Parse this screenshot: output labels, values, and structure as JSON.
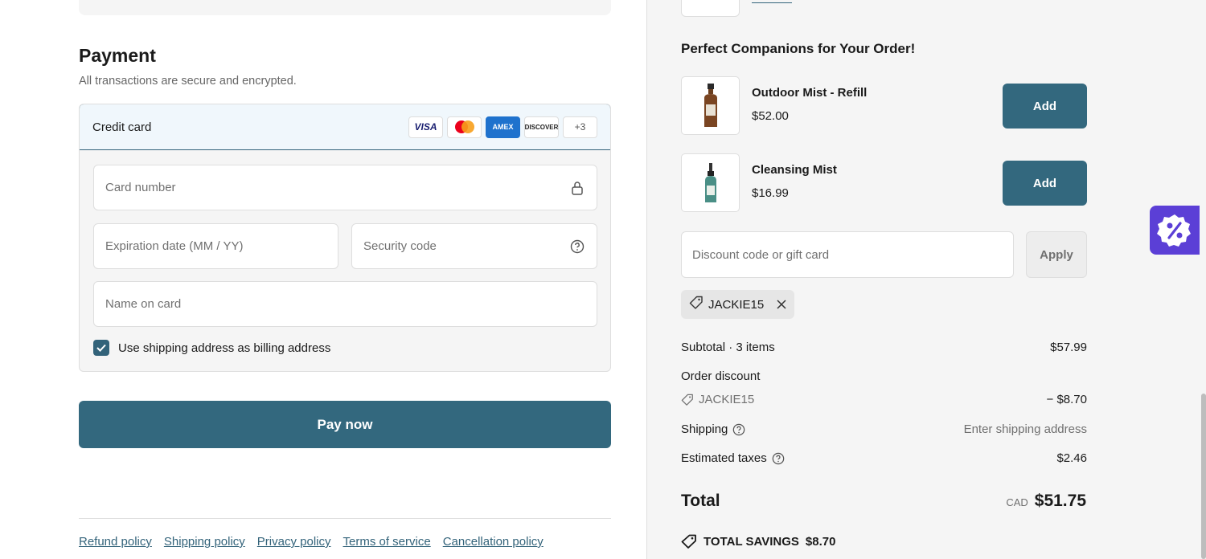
{
  "payment": {
    "title": "Payment",
    "subtitle": "All transactions are secure and encrypted.",
    "method_label": "Credit card",
    "card_logos": [
      "VISA",
      "mastercard",
      "AMEX",
      "DISCOVER"
    ],
    "more_cards": "+3",
    "fields": {
      "card_number": "Card number",
      "expiration": "Expiration date (MM / YY)",
      "security_code": "Security code",
      "name_on_card": "Name on card"
    },
    "billing_checkbox_label": "Use shipping address as billing address",
    "billing_checked": true,
    "pay_button": "Pay now"
  },
  "footer": {
    "links": [
      "Refund policy",
      "Shipping policy",
      "Privacy policy",
      "Terms of service",
      "Cancellation policy"
    ]
  },
  "sidebar": {
    "companions_title": "Perfect Companions for Your Order!",
    "products": [
      {
        "name": "Outdoor Mist - Refill",
        "price": "$52.00",
        "button": "Add"
      },
      {
        "name": "Cleansing Mist",
        "price": "$16.99",
        "button": "Add"
      }
    ],
    "discount_placeholder": "Discount code or gift card",
    "apply_button": "Apply",
    "applied_code": "JACKIE15",
    "summary": {
      "subtotal_label": "Subtotal · 3 items",
      "subtotal_value": "$57.99",
      "order_discount_label": "Order discount",
      "discount_code": "JACKIE15",
      "discount_value": "− $8.70",
      "shipping_label": "Shipping",
      "shipping_value": "Enter shipping address",
      "taxes_label": "Estimated taxes",
      "taxes_value": "$2.46",
      "total_label": "Total",
      "currency": "CAD",
      "total_value": "$51.75",
      "savings_label": "TOTAL SAVINGS",
      "savings_value": "$8.70"
    }
  },
  "colors": {
    "primary": "#33687e",
    "selected_bg": "#f0f7fc",
    "sidebar_bg": "#f5f5f5",
    "promo_badge": "#5b3fd6"
  }
}
